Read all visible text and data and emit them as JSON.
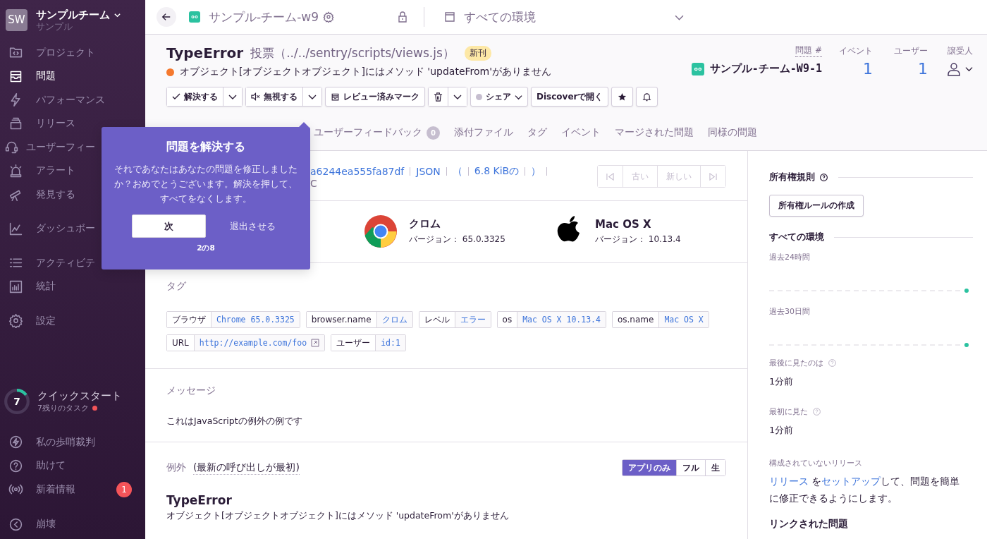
{
  "sidebar": {
    "org_initials": "SW",
    "org_name": "サンプルチーム",
    "org_sub": "サンプル",
    "sections": [
      {
        "items": [
          {
            "label": "プロジェクト",
            "selected": false
          },
          {
            "label": "問題",
            "selected": true
          },
          {
            "label": "パフォーマンス",
            "selected": false
          },
          {
            "label": "リリース",
            "selected": false
          },
          {
            "label": "ユーザーフィー",
            "selected": false
          },
          {
            "label": "アラート",
            "selected": false
          },
          {
            "label": "発見する",
            "selected": false
          }
        ]
      },
      {
        "items": [
          {
            "label": "ダッシュボー",
            "selected": false
          }
        ]
      },
      {
        "items": [
          {
            "label": "アクティビテ",
            "selected": false
          },
          {
            "label": "統計",
            "selected": false
          }
        ]
      },
      {
        "items": [
          {
            "label": "設定",
            "selected": false
          }
        ]
      }
    ],
    "quickstart": {
      "count": "7",
      "title": "クイックスタート",
      "subtitle": "7残りのタスク",
      "level": 0.15
    },
    "footer_items": [
      {
        "label": "私の歩哨裁判"
      },
      {
        "label": "助けて"
      },
      {
        "label": "新着情報",
        "badge": "1"
      }
    ],
    "collapse": {
      "label": "崩壊"
    }
  },
  "topbar": {
    "project": "サンプル-チーム-w9",
    "environment": "すべての環境"
  },
  "issue": {
    "type": "TypeError",
    "location": "投票（../../sentry/scripts/views.js）",
    "badge": "新刊",
    "message": "オブジェクト[オブジェクトオブジェクト]にはメソッド 'updateFrom'がありません"
  },
  "stats": {
    "headers": [
      "問題 #",
      "イベント",
      "ユーザー",
      "譲受人"
    ],
    "short_id": "サンプル-チーム-W9-1",
    "events": "1",
    "users": "1"
  },
  "actions": [
    {
      "kind": "split",
      "label": "解決する"
    },
    {
      "kind": "split",
      "label": "無視する"
    },
    {
      "kind": "plain",
      "label": "レビュー済みマーク"
    },
    {
      "kind": "icon-split"
    },
    {
      "kind": "dropdown",
      "label": "シェア"
    },
    {
      "kind": "plain",
      "label": "Discoverで開く"
    },
    {
      "kind": "icon"
    },
    {
      "kind": "icon"
    }
  ],
  "tabs": [
    {
      "label": "ユーザーフィードバック",
      "count": "0"
    },
    {
      "label": "添付ファイル"
    },
    {
      "label": "タグ"
    },
    {
      "label": "イベント"
    },
    {
      "label": "マージされた問題"
    },
    {
      "label": "同様の問題"
    }
  ],
  "event": {
    "id": "a6244ea555fa87df",
    "links": [
      "JSON",
      "（",
      "6.8 KiBの",
      "）"
    ],
    "line2": "C",
    "nav": [
      {
        "disabled": true
      },
      {
        "label": "古い",
        "disabled": true
      },
      {
        "label": "新しい",
        "disabled": true
      },
      {
        "disabled": true
      }
    ]
  },
  "contexts": [
    {
      "kind": "chrome",
      "name": "クロム",
      "version_label": "バージョン：",
      "version": "65.0.3325"
    },
    {
      "kind": "apple",
      "name": "Mac OS X",
      "version_label": "バージョン：",
      "version": "10.13.4"
    }
  ],
  "tags": {
    "title": "タグ",
    "items": [
      {
        "key": "ブラウザ",
        "value": "Chrome 65.0.3325"
      },
      {
        "key": "browser.name",
        "value": "クロム"
      },
      {
        "key": "レベル",
        "value": "エラー"
      },
      {
        "key": "os",
        "value": "Mac OS X 10.13.4"
      },
      {
        "key": "os.name",
        "value": "Mac OS X"
      },
      {
        "key": "URL",
        "value": "http://example.com/foo",
        "external": true
      },
      {
        "key": "ユーザー",
        "value": "id:1"
      }
    ]
  },
  "message": {
    "title": "メッセージ",
    "text": "これはJavaScriptの例外の例です"
  },
  "exception": {
    "title": "例外",
    "note": "(最新の呼び出しが最初)",
    "toggles": [
      {
        "label": "アプリのみ",
        "selected": true
      },
      {
        "label": "フル",
        "selected": false
      },
      {
        "label": "生",
        "selected": false
      }
    ],
    "type": "TypeError",
    "value": "オブジェクト[オブジェクトオブジェクト]にはメソッド 'updateFrom'がありません"
  },
  "side": {
    "ownership_title": "所有権規則",
    "ownership_button": "所有権ルールの作成",
    "env_title": "すべての環境",
    "ranges": [
      "過去24時間",
      "過去30日間"
    ],
    "seen": [
      {
        "label": "最後に見たのは",
        "value": "1分前"
      },
      {
        "label": "最初に見た",
        "value": "1分前"
      }
    ],
    "release_label": "構成されていないリリース",
    "release_parts": [
      {
        "text": "リリース",
        "link": true
      },
      {
        "text": " を",
        "link": false
      },
      {
        "text": "セットアップ",
        "link": true
      },
      {
        "text": "して、問題を簡単に修正できるようにします。",
        "link": false
      }
    ],
    "linked_title": "リンクされた問題"
  },
  "tour": {
    "title": "問題を解決する",
    "body": "それであなたはあなたの問題を修正しましたか？おめでとうございます。解決を押して、すべてをなくします。",
    "next": "次",
    "dismiss": "退出させる",
    "step": "2の8"
  }
}
